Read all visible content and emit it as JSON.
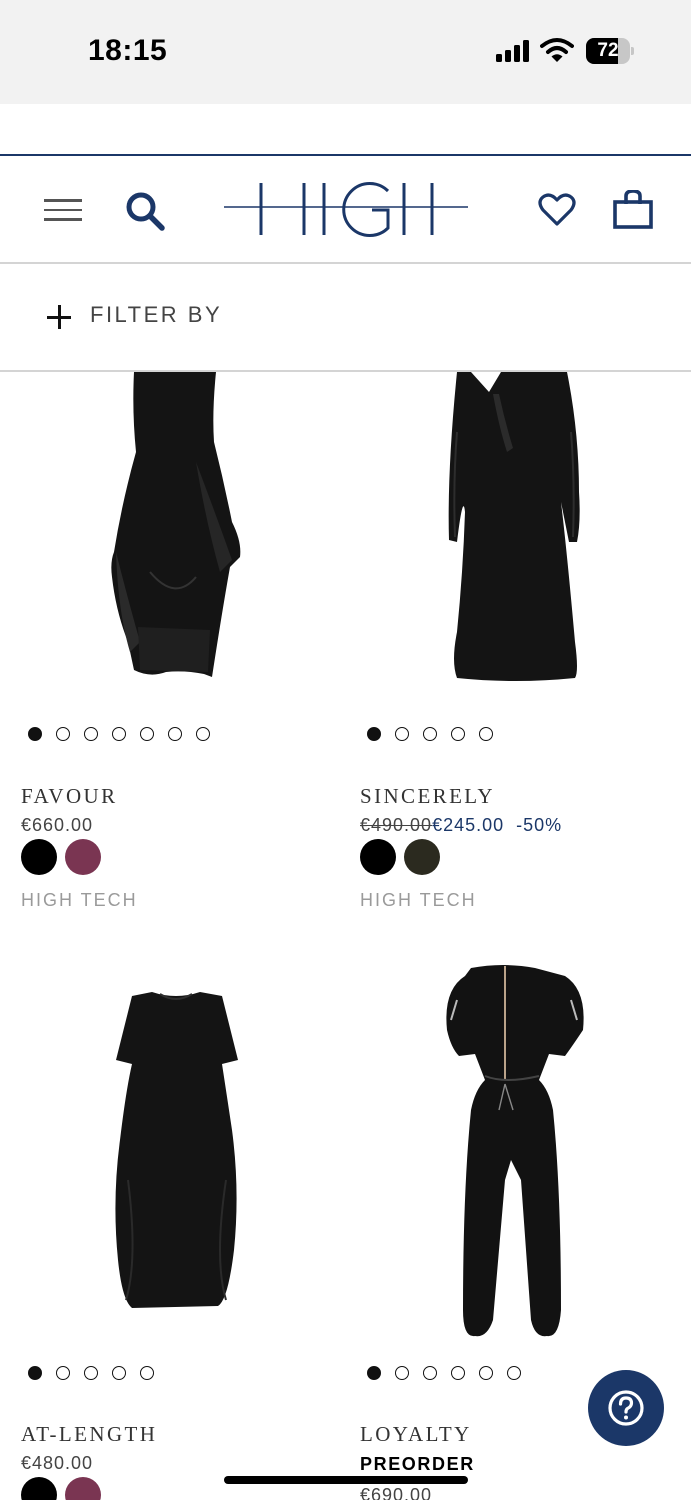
{
  "status_bar": {
    "time": "18:15",
    "battery_percent": "72",
    "battery_level": 0.72,
    "icons": [
      "signal-icon",
      "wifi-icon",
      "battery-icon"
    ]
  },
  "header": {
    "logo_text": "HIGH",
    "brand_color": "#1b3768",
    "icons": [
      "menu-icon",
      "search-icon",
      "heart-icon",
      "shopping-bag-icon"
    ]
  },
  "filter": {
    "label": "FILTER BY",
    "icon": "plus-icon"
  },
  "products": [
    {
      "name": "FAVOUR",
      "price": "€660.00",
      "image_count": 7,
      "active_image": 1,
      "colors": [
        "#000000",
        "#7a3552"
      ],
      "collection": "HIGH TECH"
    },
    {
      "name": "SINCERELY",
      "old_price": "€490.00",
      "sale_price": "€245.00",
      "discount": "-50%",
      "image_count": 5,
      "active_image": 1,
      "colors": [
        "#000000",
        "#2b2a1f"
      ],
      "collection": "HIGH TECH"
    },
    {
      "name": "AT-LENGTH",
      "price": "€480.00",
      "image_count": 5,
      "active_image": 1,
      "colors": [
        "#000000",
        "#7a3552"
      ]
    },
    {
      "name": "LOYALTY",
      "badge": "PREORDER",
      "price": "€690.00",
      "image_count": 6,
      "active_image": 1
    }
  ],
  "help": {
    "icon": "question-mark-icon"
  }
}
